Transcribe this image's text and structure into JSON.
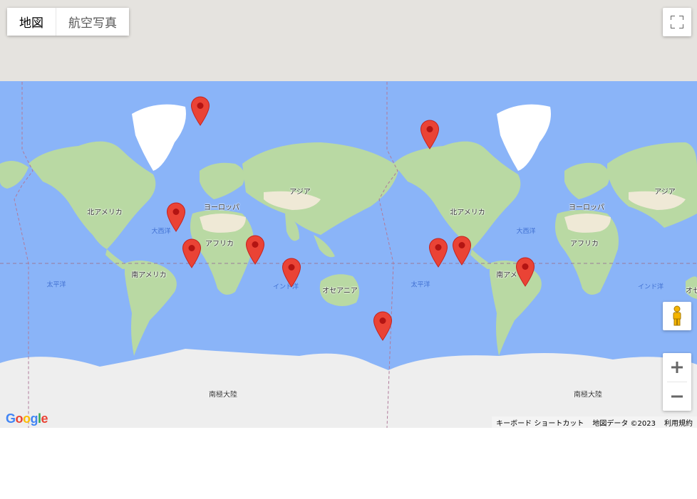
{
  "map_type_control": {
    "map_label": "地図",
    "satellite_label": "航空写真"
  },
  "labels": {
    "north_america_left": "北アメリカ",
    "europe_left": "ヨーロッパ",
    "asia_left": "アジア",
    "africa_left": "アフリカ",
    "south_america_left": "南アメリカ",
    "oceania_left": "オセアニア",
    "antarctica_left": "南極大陸",
    "atlantic_left": "大西洋",
    "pacific_left": "太平洋",
    "indian_left": "インド洋",
    "north_america_right": "北アメリカ",
    "europe_right": "ヨーロッパ",
    "asia_right": "アジア",
    "africa_right": "アフリカ",
    "south_america_right": "南アメ",
    "oceania_right": "オセ",
    "antarctica_right": "南極大陸",
    "atlantic_right": "大西洋",
    "pacific_right": "太平洋",
    "indian_right": "インド洋"
  },
  "footer": {
    "keyboard_shortcuts": "キーボード ショートカット",
    "map_data": "地図データ ©2023",
    "terms": "利用規約"
  },
  "logo": "Google",
  "colors": {
    "ocean": "#8ab4f8",
    "land": "#b9d9a3",
    "ice": "#ffffff",
    "marker": "#ea4335",
    "marker_dot": "#b31412"
  },
  "icons": {
    "fullscreen": "fullscreen-icon",
    "pegman": "pegman-icon",
    "zoom_in": "plus-icon",
    "zoom_out": "minus-icon",
    "marker": "map-pin-icon"
  }
}
